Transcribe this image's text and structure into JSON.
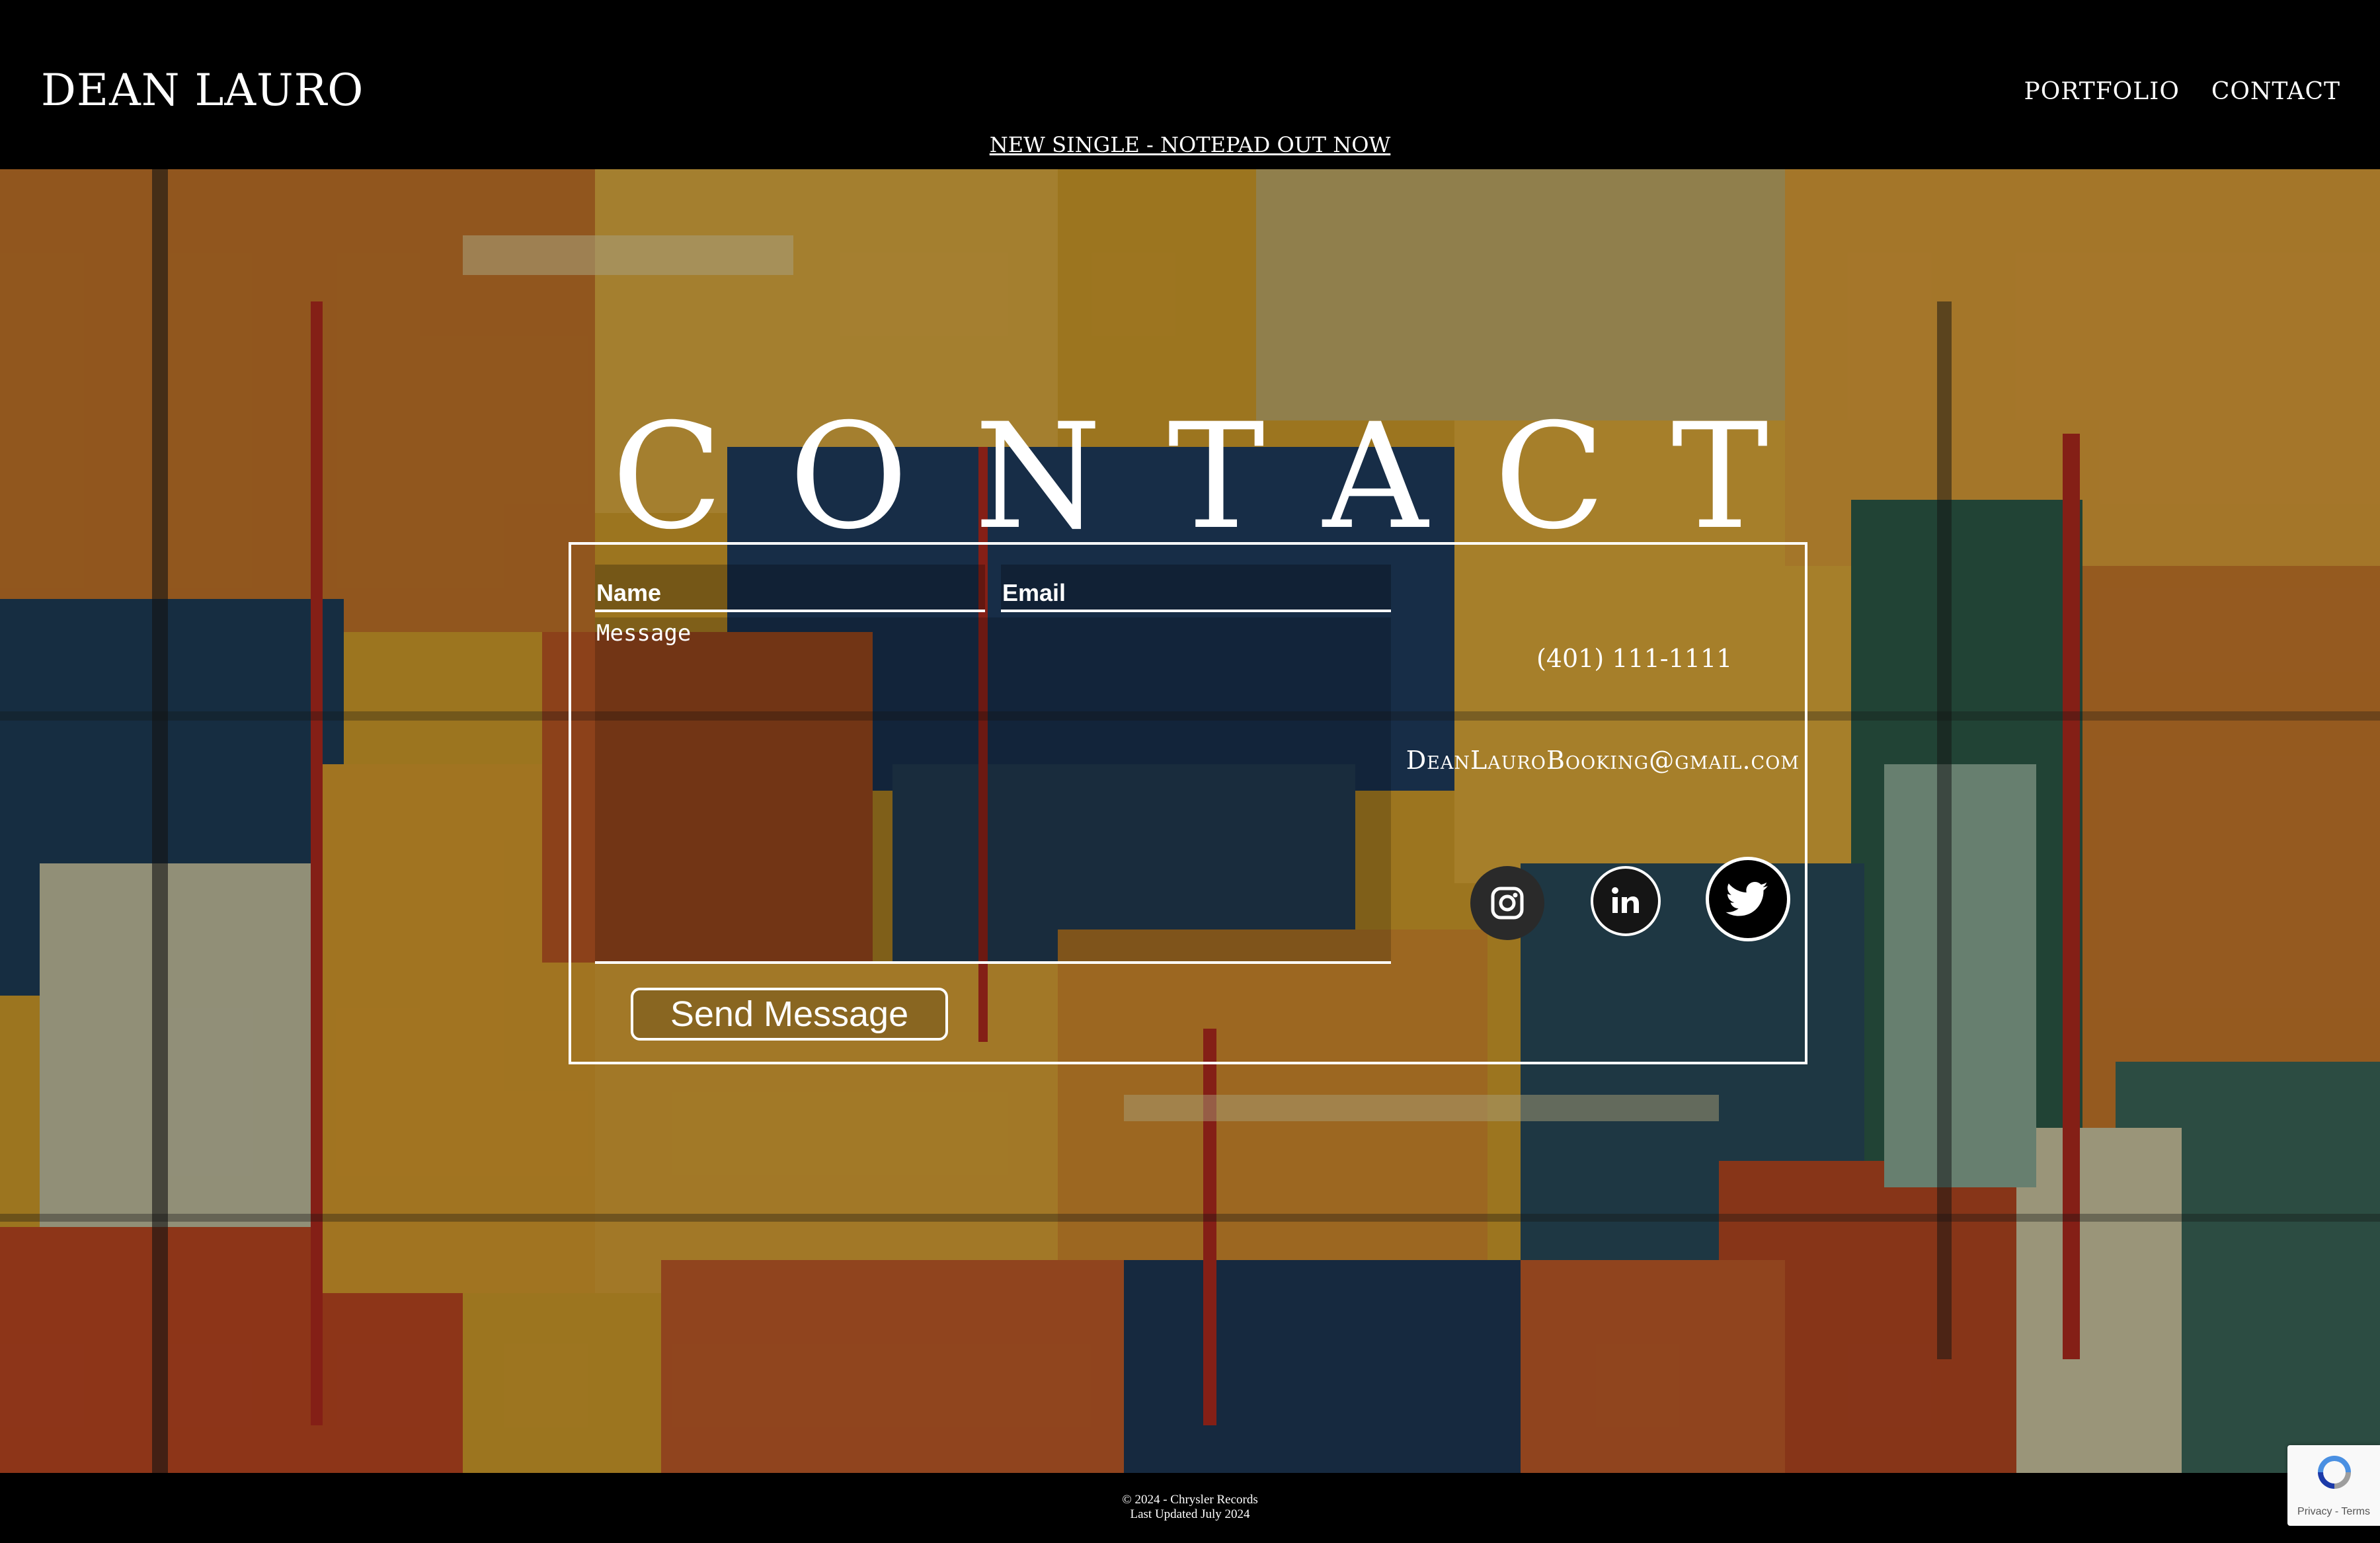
{
  "header": {
    "brand": "DEAN LAURO",
    "nav": [
      {
        "label": "PORTFOLIO"
      },
      {
        "label": "CONTACT"
      }
    ],
    "announcement": "NEW SINGLE - NOTEPAD OUT NOW"
  },
  "hero": {
    "title": "CONTACT"
  },
  "form": {
    "name_placeholder": "Name",
    "email_placeholder": "Email",
    "message_placeholder": "Message",
    "send_label": "Send Message"
  },
  "contact_info": {
    "phone": "(401) 111-1111",
    "email": "DeanLauroBooking@gmail.com"
  },
  "socials": [
    {
      "icon": "instagram-icon"
    },
    {
      "icon": "linkedin-icon"
    },
    {
      "icon": "twitter-icon"
    }
  ],
  "footer": {
    "copyright": "© 2024 - Chrysler Records",
    "updated": "Last Updated July 2024"
  },
  "recaptcha": {
    "links": "Privacy - Terms"
  }
}
